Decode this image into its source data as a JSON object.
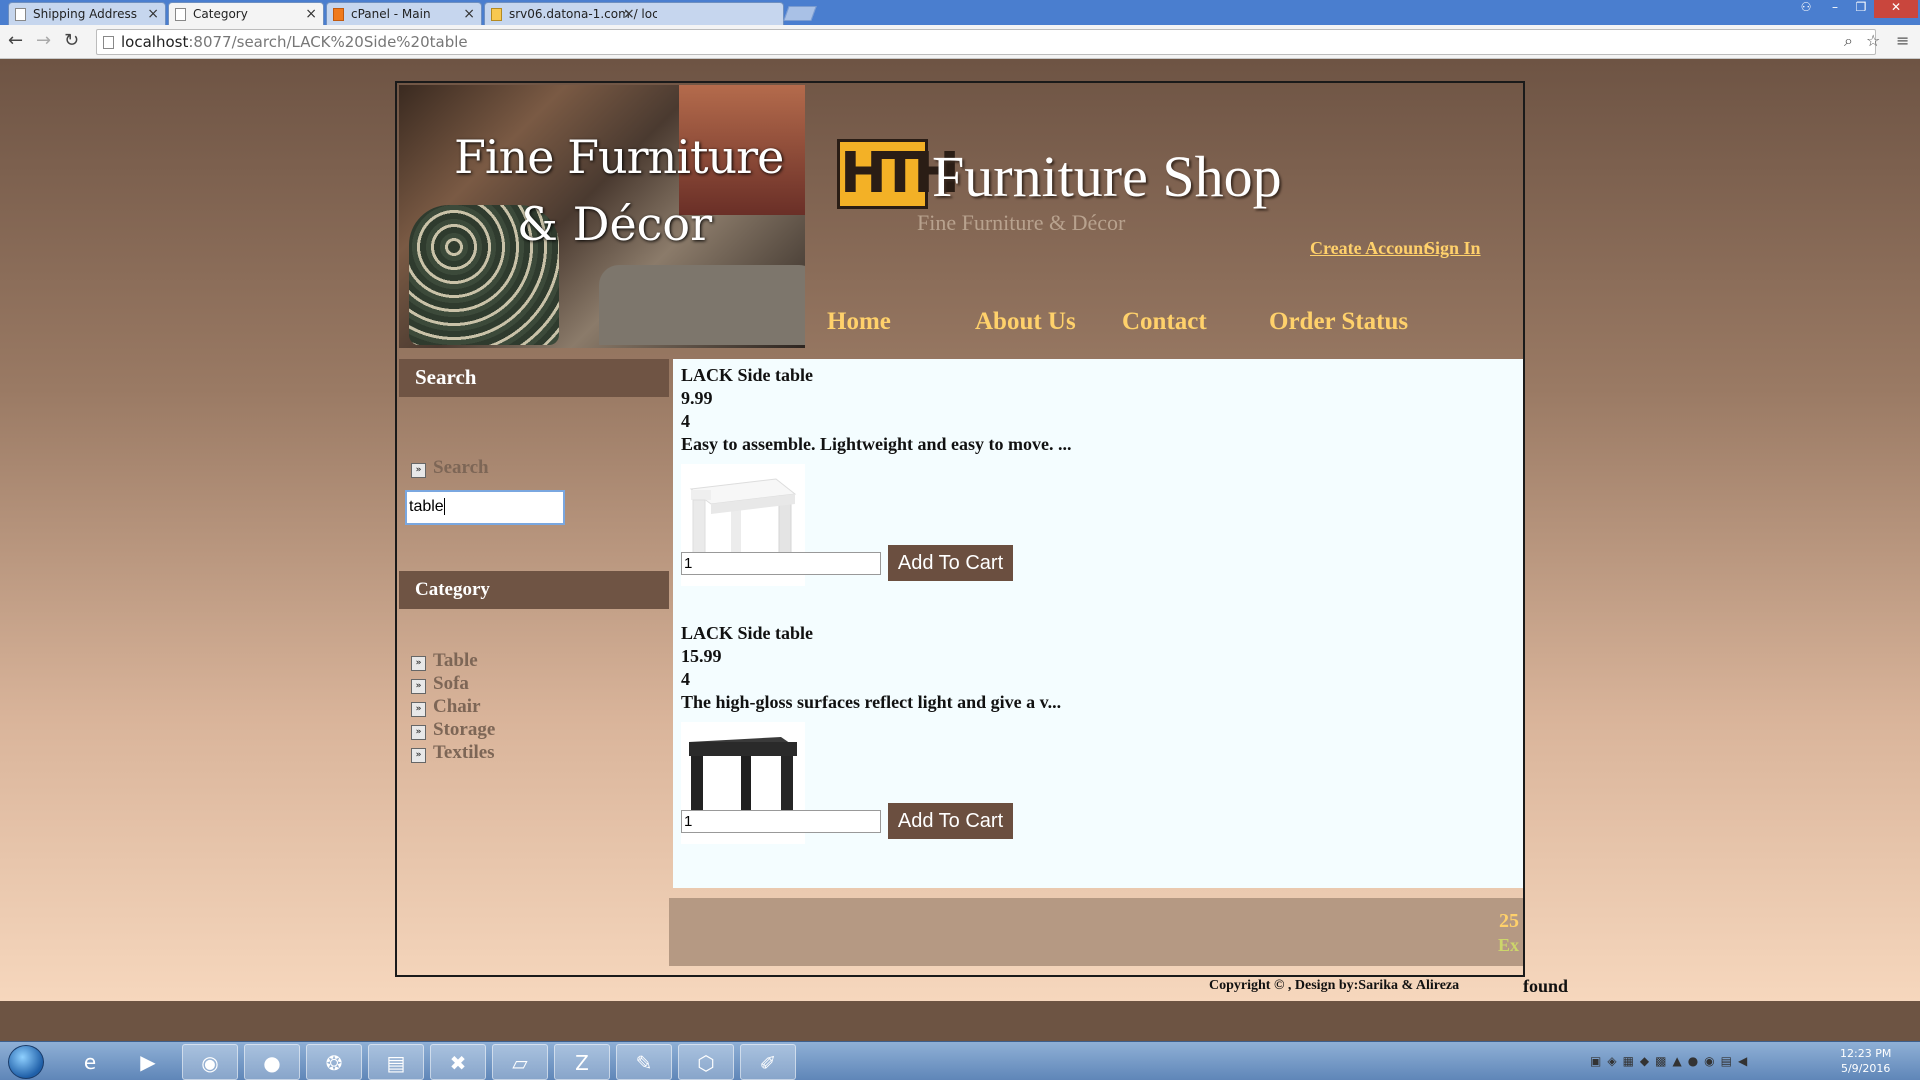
{
  "browser": {
    "tabs": [
      {
        "title": "Shipping Address"
      },
      {
        "title": "Category"
      },
      {
        "title": "cPanel - Main"
      },
      {
        "title": "srv06.datona-1.com / loca"
      }
    ],
    "url_host": "localhost",
    "url_rest": ":8077/search/LACK%20Side%20table"
  },
  "header": {
    "banner_line1": "Fine Furniture",
    "banner_line2": "& Décor",
    "logo_text": "HTH",
    "shop_name": "Furniture Shop",
    "tagline": "Fine Furniture & Décor",
    "create_account": "Create Account",
    "sign_in": "Sign In",
    "nav": [
      "Home",
      "About Us",
      "Contact",
      "Order Status"
    ]
  },
  "sidebar": {
    "search_heading": "Search",
    "search_link": "Search",
    "search_value": "table",
    "category_heading": "Category",
    "categories": [
      "Table",
      "Sofa",
      "Chair",
      "Storage",
      "Textiles"
    ]
  },
  "products": [
    {
      "name": "LACK Side table",
      "price": "9.99",
      "stock": "4",
      "desc": "Easy to assemble. Lightweight and easy to move. ...",
      "qty": "1",
      "image_color": "#f2f2f2"
    },
    {
      "name": "LACK Side table",
      "price": "15.99",
      "stock": "4",
      "desc": "The high-gloss surfaces reflect light and give a v...",
      "qty": "1",
      "image_color": "#2b2b2b"
    }
  ],
  "add_to_cart_label": "Add To Cart",
  "footer": {
    "number": "25",
    "sub": "Ex",
    "copyright": "Copyright © , Design by:Sarika & Alireza",
    "found": "found"
  },
  "taskbar": {
    "time": "12:23 PM",
    "date": "5/9/2016"
  }
}
